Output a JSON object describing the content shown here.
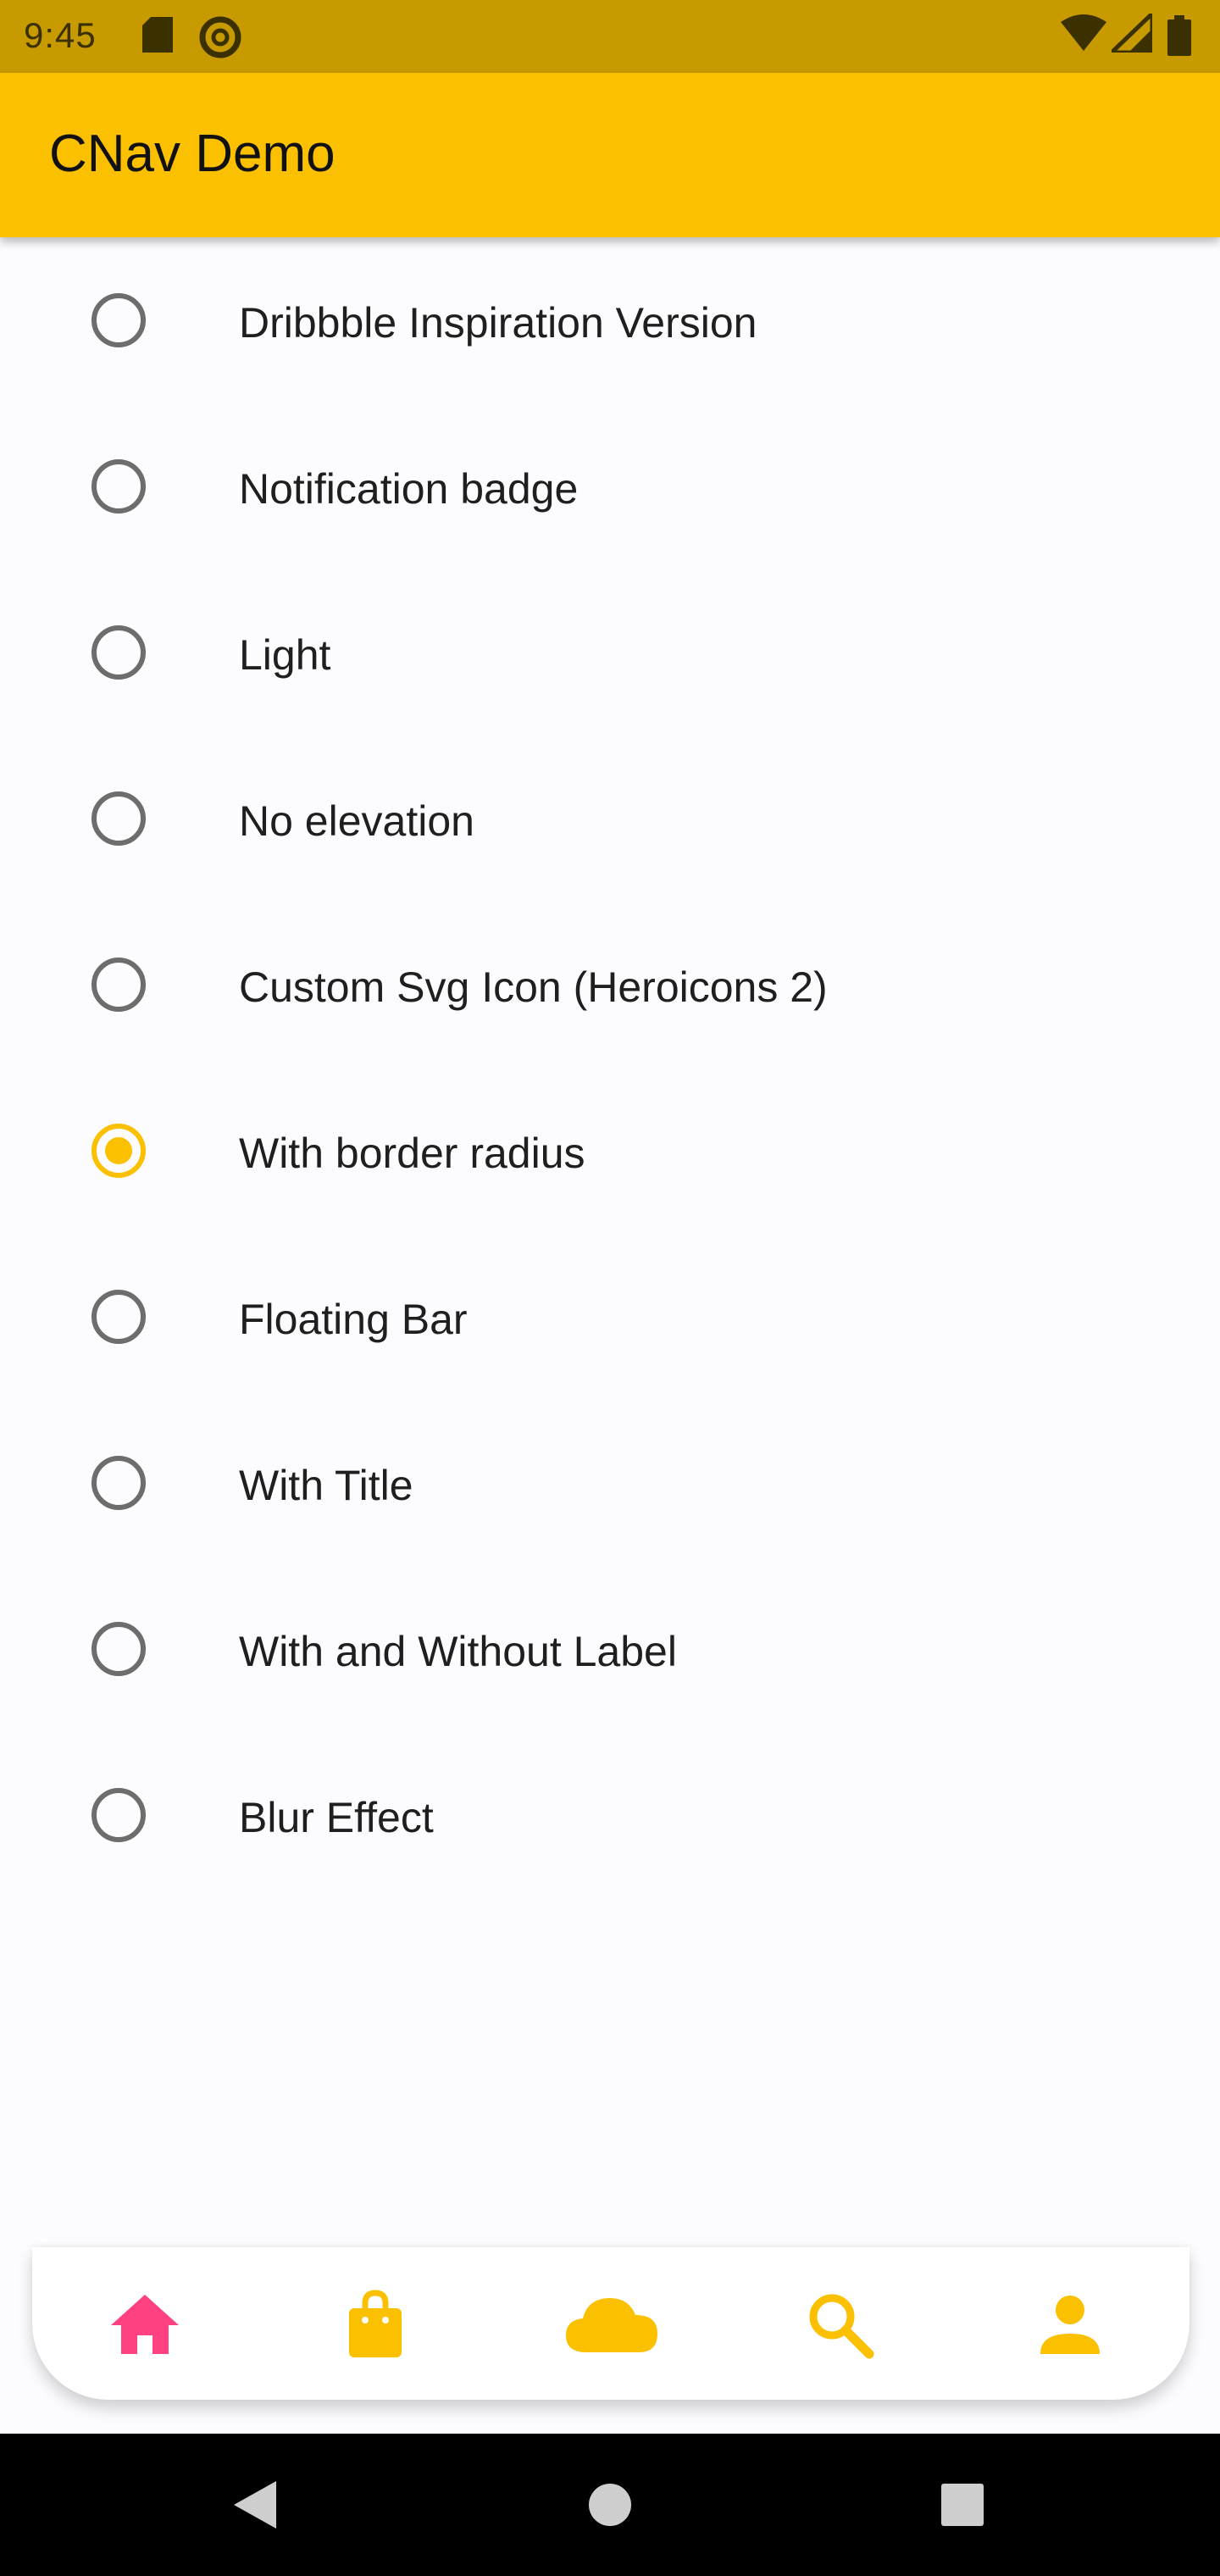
{
  "status_bar": {
    "time": "9:45",
    "icons": [
      "sd-card-icon",
      "do-not-disturb-icon",
      "wifi-icon",
      "cell-signal-icon",
      "battery-icon"
    ]
  },
  "app_bar": {
    "title": "CNav Demo"
  },
  "options": [
    {
      "label": "Dribbble Inspiration Version",
      "selected": false
    },
    {
      "label": "Notification badge",
      "selected": false
    },
    {
      "label": "Light",
      "selected": false
    },
    {
      "label": "No elevation",
      "selected": false
    },
    {
      "label": "Custom Svg Icon (Heroicons 2)",
      "selected": false
    },
    {
      "label": "With border radius",
      "selected": true
    },
    {
      "label": "Floating Bar",
      "selected": false
    },
    {
      "label": "With Title",
      "selected": false
    },
    {
      "label": "With and Without Label",
      "selected": false
    },
    {
      "label": "Blur Effect",
      "selected": false
    }
  ],
  "bottom_nav": {
    "items": [
      {
        "icon": "home-icon",
        "active": true
      },
      {
        "icon": "shopping-bag-icon",
        "active": false
      },
      {
        "icon": "cloud-icon",
        "active": false
      },
      {
        "icon": "search-icon",
        "active": false
      },
      {
        "icon": "user-icon",
        "active": false
      }
    ]
  },
  "colors": {
    "status_bar": "#c79a00",
    "accent": "#fbc000",
    "active_nav": "#ff4081",
    "radio_unselected": "#6d6d6d"
  },
  "system_nav": {
    "icons": [
      "back-icon",
      "home-circle-icon",
      "recents-icon"
    ]
  }
}
